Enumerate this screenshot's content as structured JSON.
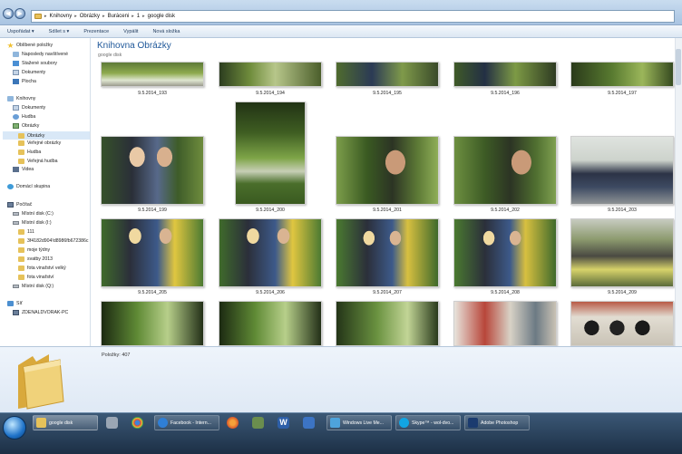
{
  "address": {
    "crumbs": [
      "Knihovny",
      "Obrázky",
      "Buráceni",
      "1",
      "google disk"
    ]
  },
  "toolbar": {
    "organize": "Uspořádat ▾",
    "share": "Sdílet s ▾",
    "slideshow": "Prezentace",
    "burn": "Vypálit",
    "new_folder": "Nová složka"
  },
  "nav": {
    "favorites": "Oblíbené položky",
    "recent": "Naposledy navštívené",
    "downloads": "Stažené soubory",
    "documents_fav": "Dokumenty",
    "desktop": "Plocha",
    "libraries": "Knihovny",
    "lib_documents": "Dokumenty",
    "lib_music": "Hudba",
    "lib_pictures": "Obrázky",
    "pictures_folder": "Obrázky",
    "public_pictures": "Veřejné obrázky",
    "music_folder": "Hudba",
    "public_music": "Veřejná hudba",
    "videos": "Videa",
    "homegroup": "Domácí skupina",
    "computer": "Počítač",
    "disk_c": "Místní disk (C:)",
    "disk_i": "Místní disk (I:)",
    "folder_111": "111",
    "folder_hash": "3f4182d904!d8986fb672386c",
    "folder_tydny": "moje týdny",
    "folder_svatby": "svatby 2013",
    "folder_fota_velky": "fota vinařství velký",
    "folder_fota": "fota vinařství",
    "disk_q": "Místní disk (Q:)",
    "network": "Síť",
    "network_pc": "ZDENALDVORAK-PC"
  },
  "library": {
    "title": "Knihovna Obrázky",
    "subtitle": "google disk"
  },
  "thumbnails": [
    {
      "caption": "9.5.2014_193"
    },
    {
      "caption": "9.5.2014_194"
    },
    {
      "caption": "9.5.2014_195"
    },
    {
      "caption": "9.5.2014_196"
    },
    {
      "caption": "9.5.2014_197"
    },
    {
      "caption": "9.5.2014_199"
    },
    {
      "caption": "9.5.2014_200"
    },
    {
      "caption": "9.5.2014_201"
    },
    {
      "caption": "9.5.2014_202"
    },
    {
      "caption": "9.5.2014_203"
    },
    {
      "caption": "9.5.2014_205"
    },
    {
      "caption": "9.5.2014_206"
    },
    {
      "caption": "9.5.2014_207"
    },
    {
      "caption": "9.5.2014_208"
    },
    {
      "caption": "9.5.2014_209"
    },
    {
      "caption": ""
    },
    {
      "caption": ""
    },
    {
      "caption": ""
    },
    {
      "caption": ""
    },
    {
      "caption": ""
    }
  ],
  "details": {
    "count": "Položky: 407"
  },
  "taskbar": {
    "google_disk": "google disk",
    "facebook": "Facebook - Intern...",
    "windows_live": "Windows Live Me...",
    "skype": "Skype™ - wol-dvo...",
    "photoshop": "Adobe Photoshop"
  }
}
